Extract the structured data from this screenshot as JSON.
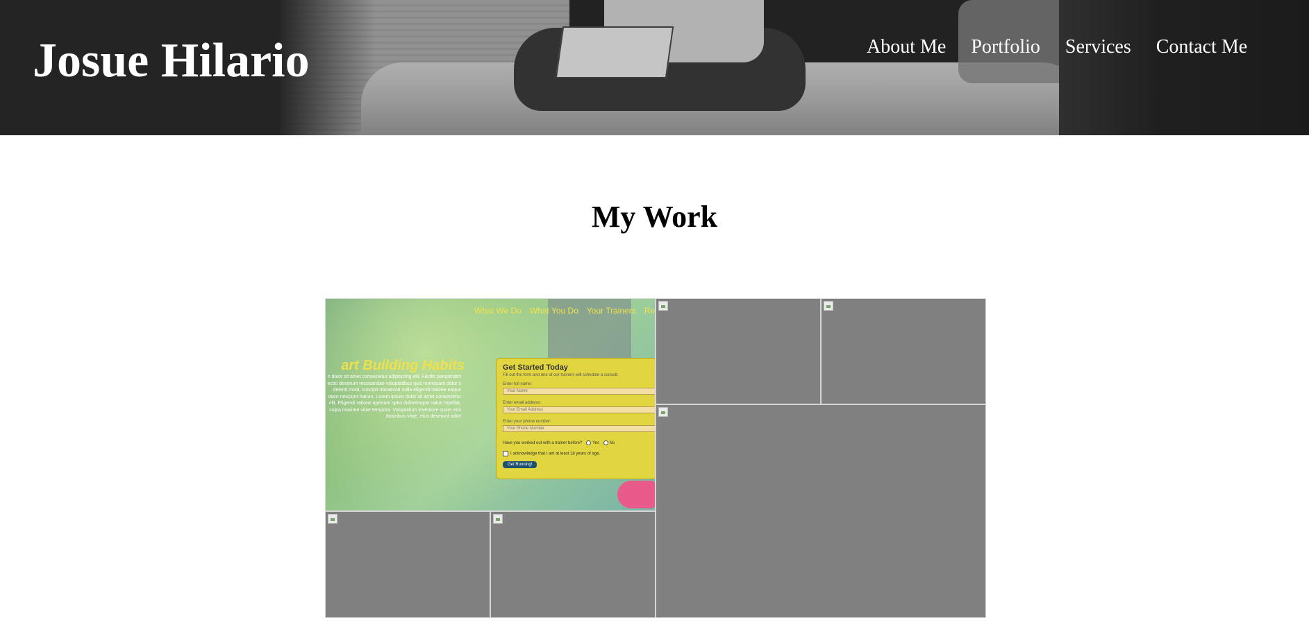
{
  "header": {
    "site_title": "Josue Hilario",
    "nav": [
      {
        "label": "About Me"
      },
      {
        "label": "Portfolio"
      },
      {
        "label": "Services"
      },
      {
        "label": "Contact Me"
      }
    ]
  },
  "main": {
    "section_title": "My Work"
  },
  "portfolio": {
    "featured": {
      "nav": [
        "What We Do",
        "What You Do",
        "Your Trainers",
        "Rea"
      ],
      "heading": "art Building Habits",
      "paragraph": "n dolor sit amet consectetur adipisicing elit. Facilis perspiciatis ectio deserunt recusandae voluptatibus quis numquam dolor s delenti modi, suscipit obcaecati nulla eligendi ratione eaque otam nesciunt harum. Lorem ipsum dolor sit amet consectetur elit. Eligendi ratione aperiam optio doloremque natus repellat, culpa maxime vitae tempora. Voluptatum inventore quam eos doloribus vitae, eius deserunt odio!",
      "form": {
        "title": "Get Started Today",
        "subtitle": "Fill out the form and one of our trainers will schedule a consult.",
        "name_label": "Enter full name:",
        "name_placeholder": "Your Name",
        "email_label": "Enter email address:",
        "email_placeholder": "Your Email Address",
        "phone_label": "Enter your phone number:",
        "phone_placeholder": "Your Phone Number",
        "question": "Have you worked out with a trainer before?",
        "yes": "Yes",
        "no": "No",
        "ack": "I acknowledge that I am at least 18 years of age.",
        "button": "Get Running!"
      }
    }
  }
}
